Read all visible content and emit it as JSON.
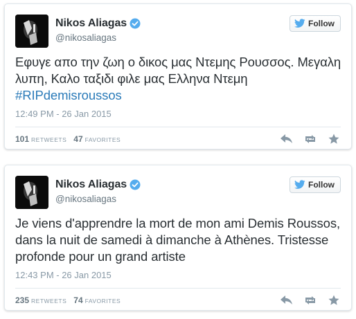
{
  "colors": {
    "name": "#292f33",
    "muted": "#66757f",
    "link": "#2b7bb9",
    "verified": "#55acee",
    "border": "#e1e8ed",
    "action_icon": "#8899a6"
  },
  "tweets": [
    {
      "display_name": "Nikos Aliagas",
      "username": "@nikosaliagas",
      "verified": true,
      "follow_label": "Follow",
      "text": "Εφυγε απο την ζωη ο δικος μας Ντεμης Ρουσσος. Μεγαλη λυπη, Καλο ταξιδι φιλε μας Ελληνα Ντεμη",
      "hashtag": "#RIPdemisroussos",
      "timestamp": "12:49 PM - 26 Jan 2015",
      "retweets": "101",
      "retweets_label": "RETWEETS",
      "favorites": "47",
      "favorites_label": "FAVORITES",
      "icons": [
        "reply-icon",
        "retweet-icon",
        "favorite-star-icon"
      ]
    },
    {
      "display_name": "Nikos Aliagas",
      "username": "@nikosaliagas",
      "verified": true,
      "follow_label": "Follow",
      "text": "Je viens d'apprendre la mort de mon ami Demis Roussos, dans la nuit de samedi à dimanche à Athènes. Tristesse profonde pour un grand artiste",
      "timestamp": "12:43 PM - 26 Jan 2015",
      "retweets": "235",
      "retweets_label": "RETWEETS",
      "favorites": "74",
      "favorites_label": "FAVORITES",
      "icons": [
        "reply-icon",
        "retweet-icon",
        "favorite-star-icon"
      ]
    }
  ]
}
